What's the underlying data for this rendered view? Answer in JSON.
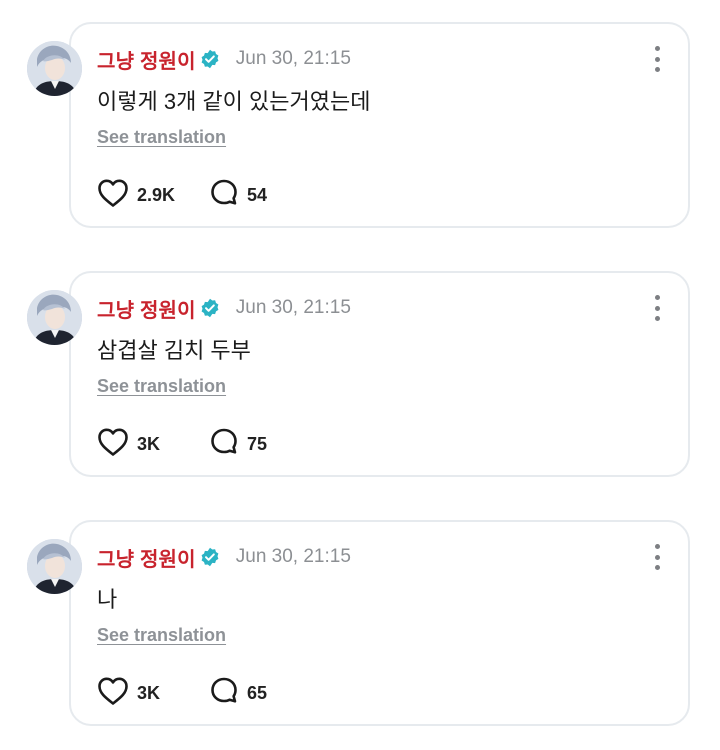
{
  "posts": [
    {
      "username": "그냥 정원이",
      "timestamp": "Jun 30, 21:15",
      "content": "이렇게 3개 같이 있는거였는데",
      "translate_label": "See translation",
      "likes": "2.9K",
      "replies": "54"
    },
    {
      "username": "그냥 정원이",
      "timestamp": "Jun 30, 21:15",
      "content": "삼겹살 김치 두부",
      "translate_label": "See translation",
      "likes": "3K",
      "replies": "75"
    },
    {
      "username": "그냥 정원이",
      "timestamp": "Jun 30, 21:15",
      "content": "나",
      "translate_label": "See translation",
      "likes": "3K",
      "replies": "65"
    }
  ],
  "icons": {
    "verified": "verified-badge-icon",
    "more": "more-vertical-icon",
    "like": "heart-icon",
    "reply": "speech-bubble-icon"
  },
  "colors": {
    "username": "#c8232d",
    "verified_badge": "#2bb3c4",
    "timestamp": "#8c8f93",
    "card_border": "#e6eaee"
  }
}
